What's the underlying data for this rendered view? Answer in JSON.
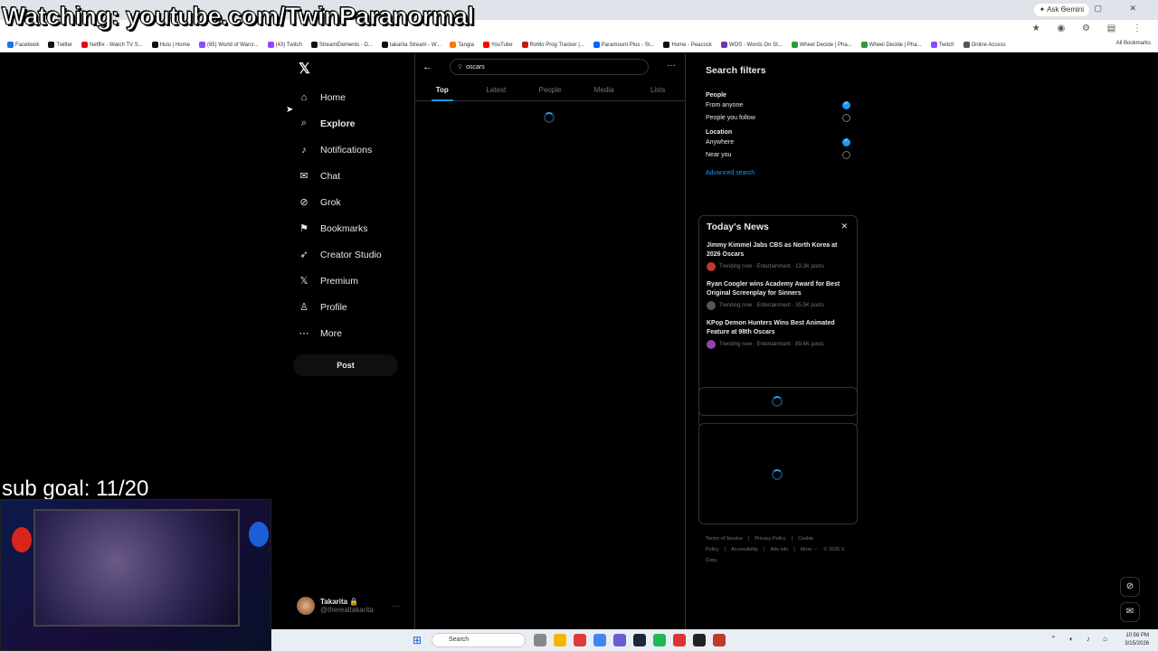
{
  "overlay": {
    "watching": "Watching: youtube.com/TwinParanormal",
    "sub_goal": "sub goal: 11/20"
  },
  "browser": {
    "ask_gemini": "✦ Ask Gemini",
    "bookmarks": [
      {
        "label": "Facebook",
        "color": "#1877f2"
      },
      {
        "label": "Twitter",
        "color": "#111111"
      },
      {
        "label": "Netflix - Watch TV S...",
        "color": "#e50914"
      },
      {
        "label": "Hulu | Home",
        "color": "#111111"
      },
      {
        "label": "(65) World of Warcr...",
        "color": "#9146ff"
      },
      {
        "label": "(43) Twitch",
        "color": "#9146ff"
      },
      {
        "label": "StreamElements - D...",
        "color": "#111111"
      },
      {
        "label": "takarita Stream - W...",
        "color": "#111111"
      },
      {
        "label": "Tangia",
        "color": "#ff7a00"
      },
      {
        "label": "YouTube",
        "color": "#ff0000"
      },
      {
        "label": "RoMo Prog Tracker |...",
        "color": "#c01a1a"
      },
      {
        "label": "Paramount Plus - St...",
        "color": "#0064ff"
      },
      {
        "label": "Home - Peacock",
        "color": "#111111"
      },
      {
        "label": "WOS - Words On St...",
        "color": "#6a3aa0"
      },
      {
        "label": "Wheel Decide | Pha...",
        "color": "#2a9a3a"
      },
      {
        "label": "Wheel Decide | Pha...",
        "color": "#2a9a3a"
      },
      {
        "label": "Twitch",
        "color": "#9146ff"
      },
      {
        "label": "Online Access",
        "color": "#555555"
      }
    ],
    "all_bookmarks": "All Bookmarks"
  },
  "sidebar": {
    "logo": "𝕏",
    "items": [
      {
        "label": "Home",
        "icon": "⌂",
        "active": false
      },
      {
        "label": "Explore",
        "icon": "⌕",
        "active": true
      },
      {
        "label": "Notifications",
        "icon": "♪",
        "active": false
      },
      {
        "label": "Chat",
        "icon": "✉",
        "active": false
      },
      {
        "label": "Grok",
        "icon": "⊘",
        "active": false
      },
      {
        "label": "Bookmarks",
        "icon": "⚑",
        "active": false
      },
      {
        "label": "Creator Studio",
        "icon": "➶",
        "active": false
      },
      {
        "label": "Premium",
        "icon": "𝕏",
        "active": false
      },
      {
        "label": "Profile",
        "icon": "♙",
        "active": false
      },
      {
        "label": "More",
        "icon": "⋯",
        "active": false
      }
    ],
    "post_label": "Post",
    "account": {
      "name": "Takarita 🔒",
      "handle": "@therealtakarita"
    }
  },
  "main": {
    "search": {
      "value": "oscars",
      "placeholder": "Search"
    },
    "tabs": [
      {
        "label": "Top",
        "active": true
      },
      {
        "label": "Latest",
        "active": false
      },
      {
        "label": "People",
        "active": false
      },
      {
        "label": "Media",
        "active": false
      },
      {
        "label": "Lists",
        "active": false
      }
    ]
  },
  "filters": {
    "title": "Search filters",
    "people_label": "People",
    "from_anyone": "From anyone",
    "people_you_follow": "People you follow",
    "location_label": "Location",
    "anywhere": "Anywhere",
    "near_you": "Near you",
    "advanced": "Advanced search"
  },
  "news": {
    "title": "Today's News",
    "items": [
      {
        "headline": "Jimmy Kimmel Jabs CBS as North Korea at 2026 Oscars",
        "meta": "Trending now · Entertainment · 13.3K posts",
        "color": "#c0392b"
      },
      {
        "headline": "Ryan Coogler wins Academy Award for Best Original Screenplay for Sinners",
        "meta": "Trending now · Entertainment · 35.5K posts",
        "color": "#555555"
      },
      {
        "headline": "KPop Demon Hunters Wins Best Animated Feature at 98th Oscars",
        "meta": "Trending now · Entertainment · 89.4K posts",
        "color": "#8e44ad"
      }
    ]
  },
  "footer": {
    "links": [
      "Terms of Service",
      "|",
      "Privacy Policy",
      "|",
      "Cookie Policy",
      "|",
      "Accessibility",
      "|",
      "Ads info",
      "|",
      "More ···",
      "© 2026 X Corp."
    ]
  },
  "taskbar": {
    "search_label": "Search",
    "time": "10:56 PM",
    "date": "3/15/2026"
  },
  "colors": {
    "accent": "#1d9bf0",
    "border": "#2f3336",
    "muted": "#71767b"
  }
}
